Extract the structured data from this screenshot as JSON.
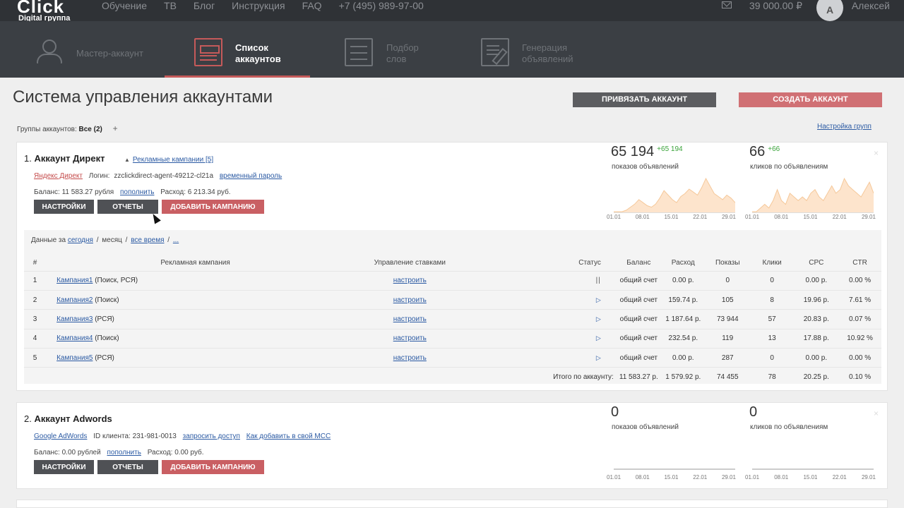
{
  "brand": {
    "logo": "Click",
    "sub": "Digital группа"
  },
  "topnav": [
    "Обучение",
    "ТВ",
    "Блог",
    "Инструкция",
    "FAQ",
    "+7 (495) 989-97-00"
  ],
  "user": {
    "balance": "39 000.00 ₽",
    "avatar_letter": "А",
    "name": "Алексей"
  },
  "sections": [
    {
      "label1": "Мастер-аккаунт",
      "label2": "",
      "icon": "person-icon"
    },
    {
      "label1": "Список",
      "label2": "аккаунтов",
      "icon": "list-icon"
    },
    {
      "label1": "Подбор",
      "label2": "слов",
      "icon": "sliders-icon"
    },
    {
      "label1": "Генерация",
      "label2": "объявлений",
      "icon": "edit-icon"
    }
  ],
  "page": {
    "title": "Система управления аккаунтами",
    "btn_link": "ПРИВЯЗАТЬ АККАУНТ",
    "btn_create": "СОЗДАТЬ АККАУНТ",
    "groups_label": "Группы аккаунтов:",
    "groups_value": "Все (2)",
    "groups_plus": "+",
    "groups_settings": "Настройка групп"
  },
  "accounts": [
    {
      "num": "1.",
      "name": "Аккаунт Директ",
      "campaigns_link": "Рекламные кампании [5]",
      "system": "Яндекс Директ",
      "login_label": "Логин:",
      "login": "zzclickdirect-agent-49212-cl21a",
      "login_action": "временный пароль",
      "balance_label": "Баланс:",
      "balance": "11 583.27 рубля",
      "topup": "пополнить",
      "expense_label": "Расход:",
      "expense": "6 213.34 руб.",
      "btn_settings": "НАСТРОЙКИ",
      "btn_reports": "ОТЧЕТЫ",
      "btn_add": "ДОБАВИТЬ КАМПАНИЮ",
      "impressions": "65 194",
      "impressions_delta": "+65 194",
      "impressions_label": "показов объявлений",
      "clicks": "66",
      "clicks_delta": "+66",
      "clicks_label": "кликов по объявлениям",
      "close": "×"
    },
    {
      "num": "2.",
      "name": "Аккаунт Adwords",
      "system": "Google AdWords",
      "client_label": "ID клиента:",
      "client_id": "231-981-0013",
      "request_access": "запросить доступ",
      "how_add": "Как добавить в свой МСС",
      "balance_label": "Баланс:",
      "balance": "0.00 рублей",
      "topup": "пополнить",
      "expense_label": "Расход:",
      "expense": "0.00 руб.",
      "btn_settings": "НАСТРОЙКИ",
      "btn_reports": "ОТЧЕТЫ",
      "btn_add": "ДОБАВИТЬ КАМПАНИЮ",
      "impressions": "0",
      "impressions_label": "показов объявлений",
      "clicks": "0",
      "clicks_label": "кликов по объявлениям",
      "close": "×"
    }
  ],
  "spark_ticks": [
    "01.01",
    "08.01",
    "15.01",
    "22.01",
    "29.01"
  ],
  "spark_impressions": [
    0,
    0,
    0,
    1,
    3,
    5,
    8,
    6,
    4,
    3,
    5,
    9,
    14,
    11,
    8,
    6,
    10,
    12,
    15,
    13,
    11,
    16,
    22,
    17,
    12,
    10,
    8,
    11,
    9,
    6
  ],
  "spark_clicks": [
    0,
    0,
    1,
    2,
    1,
    3,
    6,
    3,
    2,
    5,
    4,
    3,
    4,
    3,
    5,
    6,
    4,
    3,
    5,
    7,
    5,
    6,
    9,
    7,
    6,
    5,
    4,
    6,
    8,
    5
  ],
  "range": {
    "label": "Данные за",
    "today": "сегодня",
    "month": "месяц",
    "all": "все время",
    "more": "...",
    "sep": "/"
  },
  "table": {
    "headers": [
      "#",
      "Рекламная кампания",
      "Управление ставками",
      "Статус",
      "Баланс",
      "Расход",
      "Показы",
      "Клики",
      "CPC",
      "CTR"
    ],
    "rows": [
      {
        "n": "1",
        "name": "Кампания1",
        "type": "(Поиск, РСЯ)",
        "bid": "настроить",
        "status": "pause",
        "balance": "общий счет",
        "expense": "0.00 р.",
        "imp": "0",
        "clk": "0",
        "cpc": "0.00 р.",
        "ctr": "0.00 %"
      },
      {
        "n": "2",
        "name": "Кампания2",
        "type": "(Поиск)",
        "bid": "настроить",
        "status": "play",
        "balance": "общий счет",
        "expense": "159.74 р.",
        "imp": "105",
        "clk": "8",
        "cpc": "19.96 р.",
        "ctr": "7.61 %"
      },
      {
        "n": "3",
        "name": "Кампания3",
        "type": "(РСЯ)",
        "bid": "настроить",
        "status": "play",
        "balance": "общий счет",
        "expense": "1 187.64 р.",
        "imp": "73 944",
        "clk": "57",
        "cpc": "20.83 р.",
        "ctr": "0.07 %"
      },
      {
        "n": "4",
        "name": "Кампания4",
        "type": "(Поиск)",
        "bid": "настроить",
        "status": "play",
        "balance": "общий счет",
        "expense": "232.54 р.",
        "imp": "119",
        "clk": "13",
        "cpc": "17.88 р.",
        "ctr": "10.92 %"
      },
      {
        "n": "5",
        "name": "Кампания5",
        "type": "(РСЯ)",
        "bid": "настроить",
        "status": "play",
        "balance": "общий счет",
        "expense": "0.00 р.",
        "imp": "287",
        "clk": "0",
        "cpc": "0.00 р.",
        "ctr": "0.00 %"
      }
    ],
    "total": {
      "label": "Итого по аккаунту:",
      "balance": "11 583.27 р.",
      "expense": "1 579.92 р.",
      "imp": "74 455",
      "clk": "78",
      "cpc": "20.25 р.",
      "ctr": "0.10 %"
    }
  },
  "icons": {
    "play": "▷",
    "pause": "||",
    "tri": "▲"
  },
  "colors": {
    "accent": "#c95f63",
    "topbar": "#2f3236",
    "nav": "#3b3f44",
    "link": "#2b5aa3",
    "spark_fill": "#fde4cc",
    "spark_line": "#f5c89a",
    "delta": "#3aa33a"
  }
}
